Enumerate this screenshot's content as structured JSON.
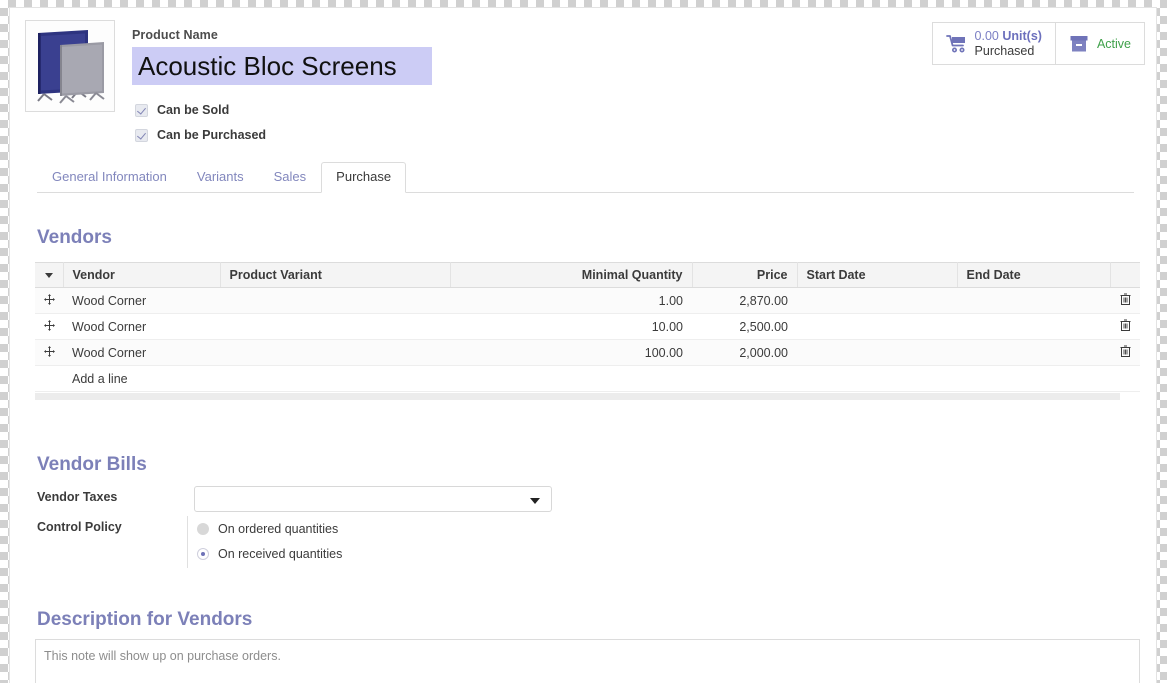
{
  "header": {
    "product_image_alt": "acoustic-screens-thumbnail",
    "product_name_label": "Product Name",
    "product_name_value": "Acoustic Bloc Screens",
    "checkboxes": [
      {
        "label": "Can be Sold",
        "checked": true
      },
      {
        "label": "Can be Purchased",
        "checked": true
      }
    ],
    "stat_buttons": [
      {
        "icon": "shopping-cart-icon",
        "value": "0.00",
        "unit": "Unit(s)",
        "caption": "Purchased"
      },
      {
        "icon": "archive-box-icon",
        "status": "Active"
      }
    ]
  },
  "tabs": [
    {
      "label": "General Information",
      "active": false
    },
    {
      "label": "Variants",
      "active": false
    },
    {
      "label": "Sales",
      "active": false
    },
    {
      "label": "Purchase",
      "active": true
    }
  ],
  "vendors": {
    "title": "Vendors",
    "columns": [
      "Vendor",
      "Product Variant",
      "Minimal Quantity",
      "Price",
      "Start Date",
      "End Date"
    ],
    "rows": [
      {
        "vendor": "Wood Corner",
        "product_variant": "",
        "minimal_quantity": "1.00",
        "price": "2,870.00",
        "start_date": "",
        "end_date": ""
      },
      {
        "vendor": "Wood Corner",
        "product_variant": "",
        "minimal_quantity": "10.00",
        "price": "2,500.00",
        "start_date": "",
        "end_date": ""
      },
      {
        "vendor": "Wood Corner",
        "product_variant": "",
        "minimal_quantity": "100.00",
        "price": "2,000.00",
        "start_date": "",
        "end_date": ""
      }
    ],
    "add_line_label": "Add a line"
  },
  "vendor_bills": {
    "title": "Vendor Bills",
    "vendor_taxes_label": "Vendor Taxes",
    "vendor_taxes_value": "",
    "control_policy_label": "Control Policy",
    "control_policy_options": [
      {
        "label": "On ordered quantities",
        "selected": false
      },
      {
        "label": "On received quantities",
        "selected": true
      }
    ]
  },
  "description": {
    "title": "Description for Vendors",
    "placeholder": "This note will show up on purchase orders.",
    "value": ""
  },
  "colors": {
    "accent": "#7c80b8",
    "link": "#8287bd",
    "selection": "#ccccf5",
    "active_status": "#3fa14a",
    "text": "#3b3b3b",
    "border": "#dcdcdc"
  }
}
